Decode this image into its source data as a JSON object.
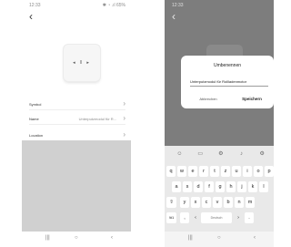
{
  "left": {
    "status": {
      "time": "12:33",
      "icons": "✱ ◔ .ıl 65%"
    },
    "device_controls": "◂ ‖ ▸",
    "rows": [
      {
        "label": "Symbol",
        "value": ""
      },
      {
        "label": "Name",
        "value": "Unterputzmodul für R..."
      },
      {
        "label": "Location",
        "value": ""
      }
    ]
  },
  "right": {
    "status": {
      "time": "12:33"
    },
    "dialog": {
      "title": "Umbenennen",
      "input_value": "Unterputzmodul für Rollladenmotor",
      "cancel": "Abbrechen",
      "save": "Speichern"
    },
    "keyboard": {
      "tools": [
        "☺",
        "▭",
        "⚙",
        "♪",
        "⚙"
      ],
      "row1": [
        "q",
        "w",
        "e",
        "r",
        "t",
        "z",
        "u",
        "i",
        "o",
        "p"
      ],
      "row2": [
        "a",
        "s",
        "d",
        "f",
        "g",
        "h",
        "j",
        "k",
        "l"
      ],
      "row3": [
        "⇧",
        "y",
        "x",
        "c",
        "v",
        "b",
        "n",
        "m"
      ],
      "row4": [
        "!#1",
        ",",
        "‹",
        "Deutsch",
        "›",
        "."
      ],
      "space_label": "Deutsch"
    }
  },
  "nav": {
    "recents": "|||",
    "home": "○",
    "back": "‹"
  }
}
